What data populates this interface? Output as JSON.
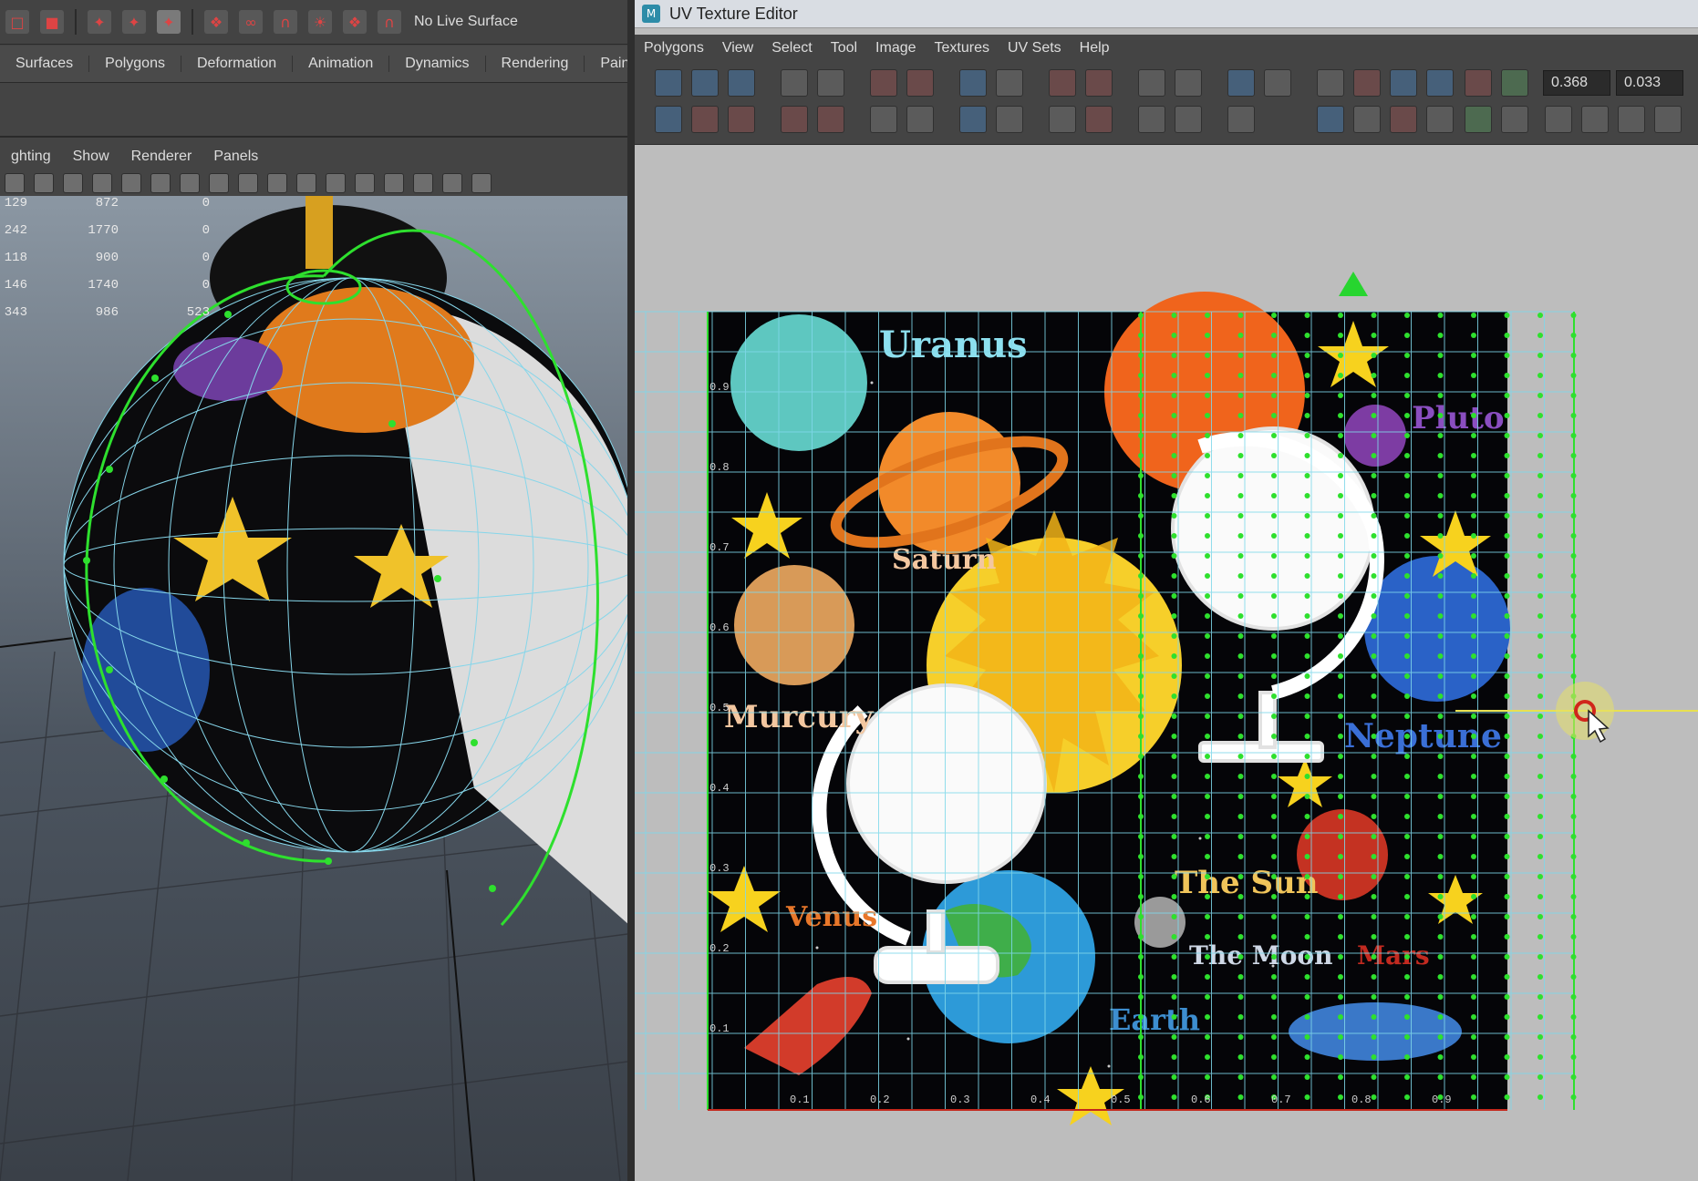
{
  "main_toolbar": {
    "live_surface_label": "No Live Surface"
  },
  "shelf_tabs": [
    "Surfaces",
    "Polygons",
    "Deformation",
    "Animation",
    "Dynamics",
    "Rendering",
    "Pain"
  ],
  "viewport_menu": [
    "ghting",
    "Show",
    "Renderer",
    "Panels"
  ],
  "heads_up_display": {
    "rows": [
      [
        "129",
        "872",
        "0"
      ],
      [
        "242",
        "1770",
        "0"
      ],
      [
        "118",
        "900",
        "0"
      ],
      [
        "146",
        "1740",
        "0"
      ],
      [
        "343",
        "986",
        "523"
      ]
    ]
  },
  "uv_editor": {
    "title": "UV Texture Editor",
    "menu": [
      "Polygons",
      "View",
      "Select",
      "Tool",
      "Image",
      "Textures",
      "UV Sets",
      "Help"
    ],
    "field_u": "0.368",
    "field_v": "0.033",
    "axis_ticks_u": [
      "0.1",
      "0.2",
      "0.3",
      "0.4",
      "0.5",
      "0.6",
      "0.7",
      "0.8",
      "0.9"
    ],
    "axis_ticks_v": [
      "0.9",
      "0.8",
      "0.7",
      "0.6",
      "0.5",
      "0.4",
      "0.3",
      "0.2",
      "0.1"
    ],
    "texture_labels": {
      "uranus": "Uranus",
      "saturn": "Saturn",
      "mercury": "Murcury",
      "venus": "Venus",
      "earth": "Earth",
      "pluto": "Pluto",
      "neptune": "Neptune",
      "the_sun": "The Sun",
      "the_moon": "The Moon",
      "mars": "Mars"
    }
  },
  "colors": {
    "uv_wire": "#7fd8ea",
    "uv_points": "#2ee02e",
    "space_bg": "#000000",
    "ui_dark": "#444444"
  }
}
